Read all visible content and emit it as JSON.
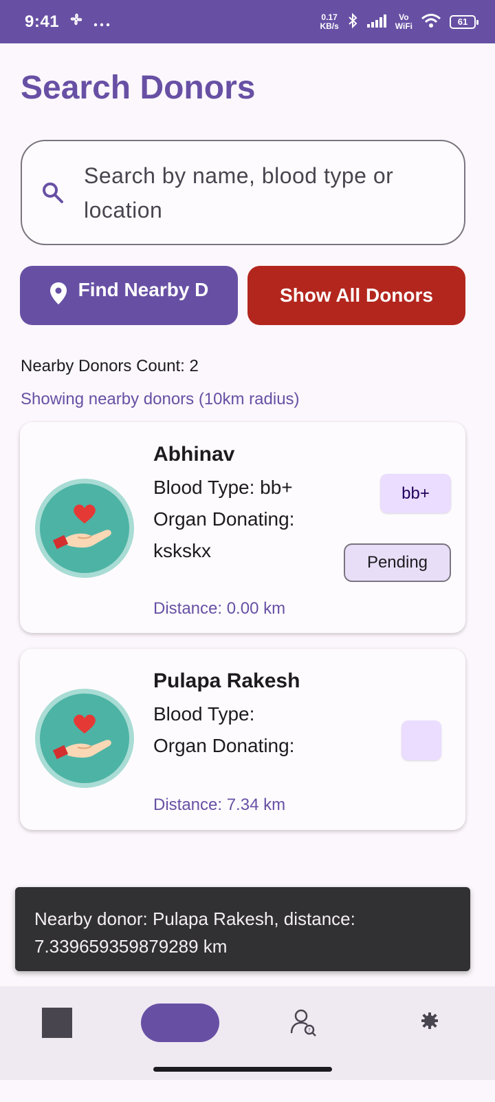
{
  "status_bar": {
    "time": "9:41",
    "net_speed_value": "0.17",
    "net_speed_unit": "KB/s",
    "network_label_top": "Vo",
    "network_label_bottom": "WiFi",
    "battery": "61",
    "icons": [
      "fan-icon",
      "more-dots-icon",
      "bluetooth-icon",
      "signal-icon",
      "wifi-icon",
      "battery-icon"
    ]
  },
  "page": {
    "title": "Search Donors"
  },
  "search": {
    "placeholder": "Search by name, blood type or location",
    "icon": "search-icon"
  },
  "actions": {
    "find_nearby_label": "Find Nearby D",
    "find_nearby_icon": "location-pin-icon",
    "show_all_label": "Show All Donors"
  },
  "summary": {
    "count_text": "Nearby Donors Count: 2",
    "radius_text": "Showing nearby donors (10km radius)"
  },
  "donors": [
    {
      "name": "Abhinav",
      "blood_type_text": "Blood Type: bb+",
      "organ_text": "Organ Donating: kskskx",
      "blood_chip": "bb+",
      "status": "Pending",
      "distance_text": "Distance: 0.00 km"
    },
    {
      "name": "Pulapa Rakesh",
      "blood_type_text": "Blood Type:",
      "organ_text": "Organ Donating:",
      "blood_chip": "",
      "distance_text": "Distance: 7.34 km"
    }
  ],
  "toast": {
    "message": "Nearby donor: Pulapa Rakesh, distance: 7.339659359879289 km"
  },
  "bottom_nav": {
    "items": [
      "home-square-icon",
      "active-tab-pill",
      "user-search-icon",
      "settings-gear-icon"
    ]
  },
  "colors": {
    "primary": "#6750A4",
    "danger": "#B3261E",
    "background": "#FCF7FC",
    "toast": "#313033"
  }
}
